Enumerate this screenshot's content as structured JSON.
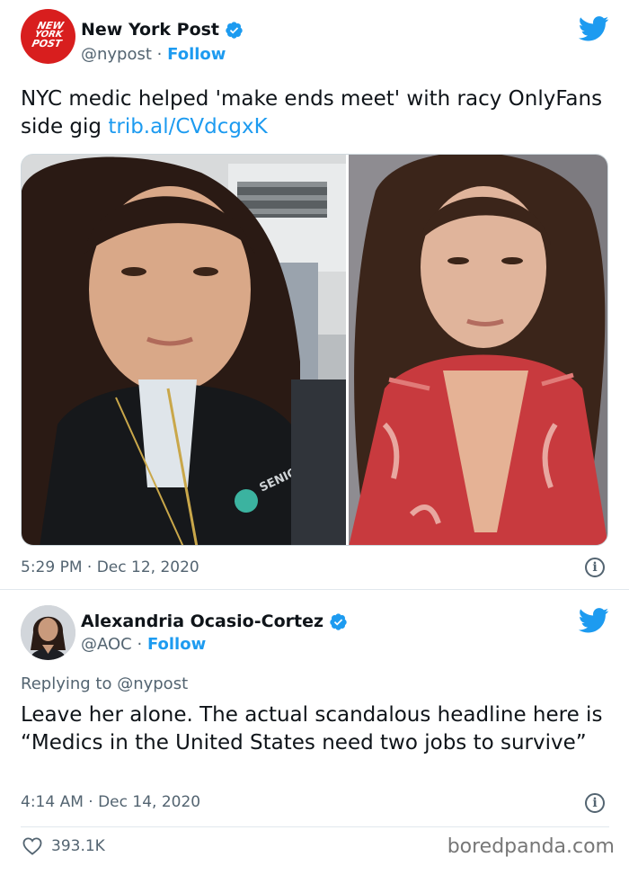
{
  "tweet1": {
    "avatar_text": [
      "NEW",
      "YORK",
      "POST"
    ],
    "name": "New York Post",
    "handle": "@nypost",
    "separator": "·",
    "follow": "Follow",
    "text": "NYC medic helped 'make ends meet' with racy OnlyFans side gig",
    "link": "trib.al/CVdcgxK",
    "jacket_text": "SENIORCI EMS",
    "timestamp": "5:29 PM · Dec 12, 2020",
    "info": "i"
  },
  "tweet2": {
    "name": "Alexandria Ocasio-Cortez",
    "handle": "@AOC",
    "separator": "·",
    "follow": "Follow",
    "replying_to": "Replying to @nypost",
    "text": "Leave her alone. The actual scandalous headline here is “Medics in the United States need two jobs to survive”",
    "timestamp": "4:14 AM · Dec 14, 2020",
    "info": "i",
    "likes": "393.1K"
  },
  "watermark": "boredpanda.com",
  "colors": {
    "twitter_blue": "#1d9bf0",
    "nypost_red": "#d81e1e",
    "text_primary": "#0f1419",
    "text_secondary": "#536471"
  }
}
